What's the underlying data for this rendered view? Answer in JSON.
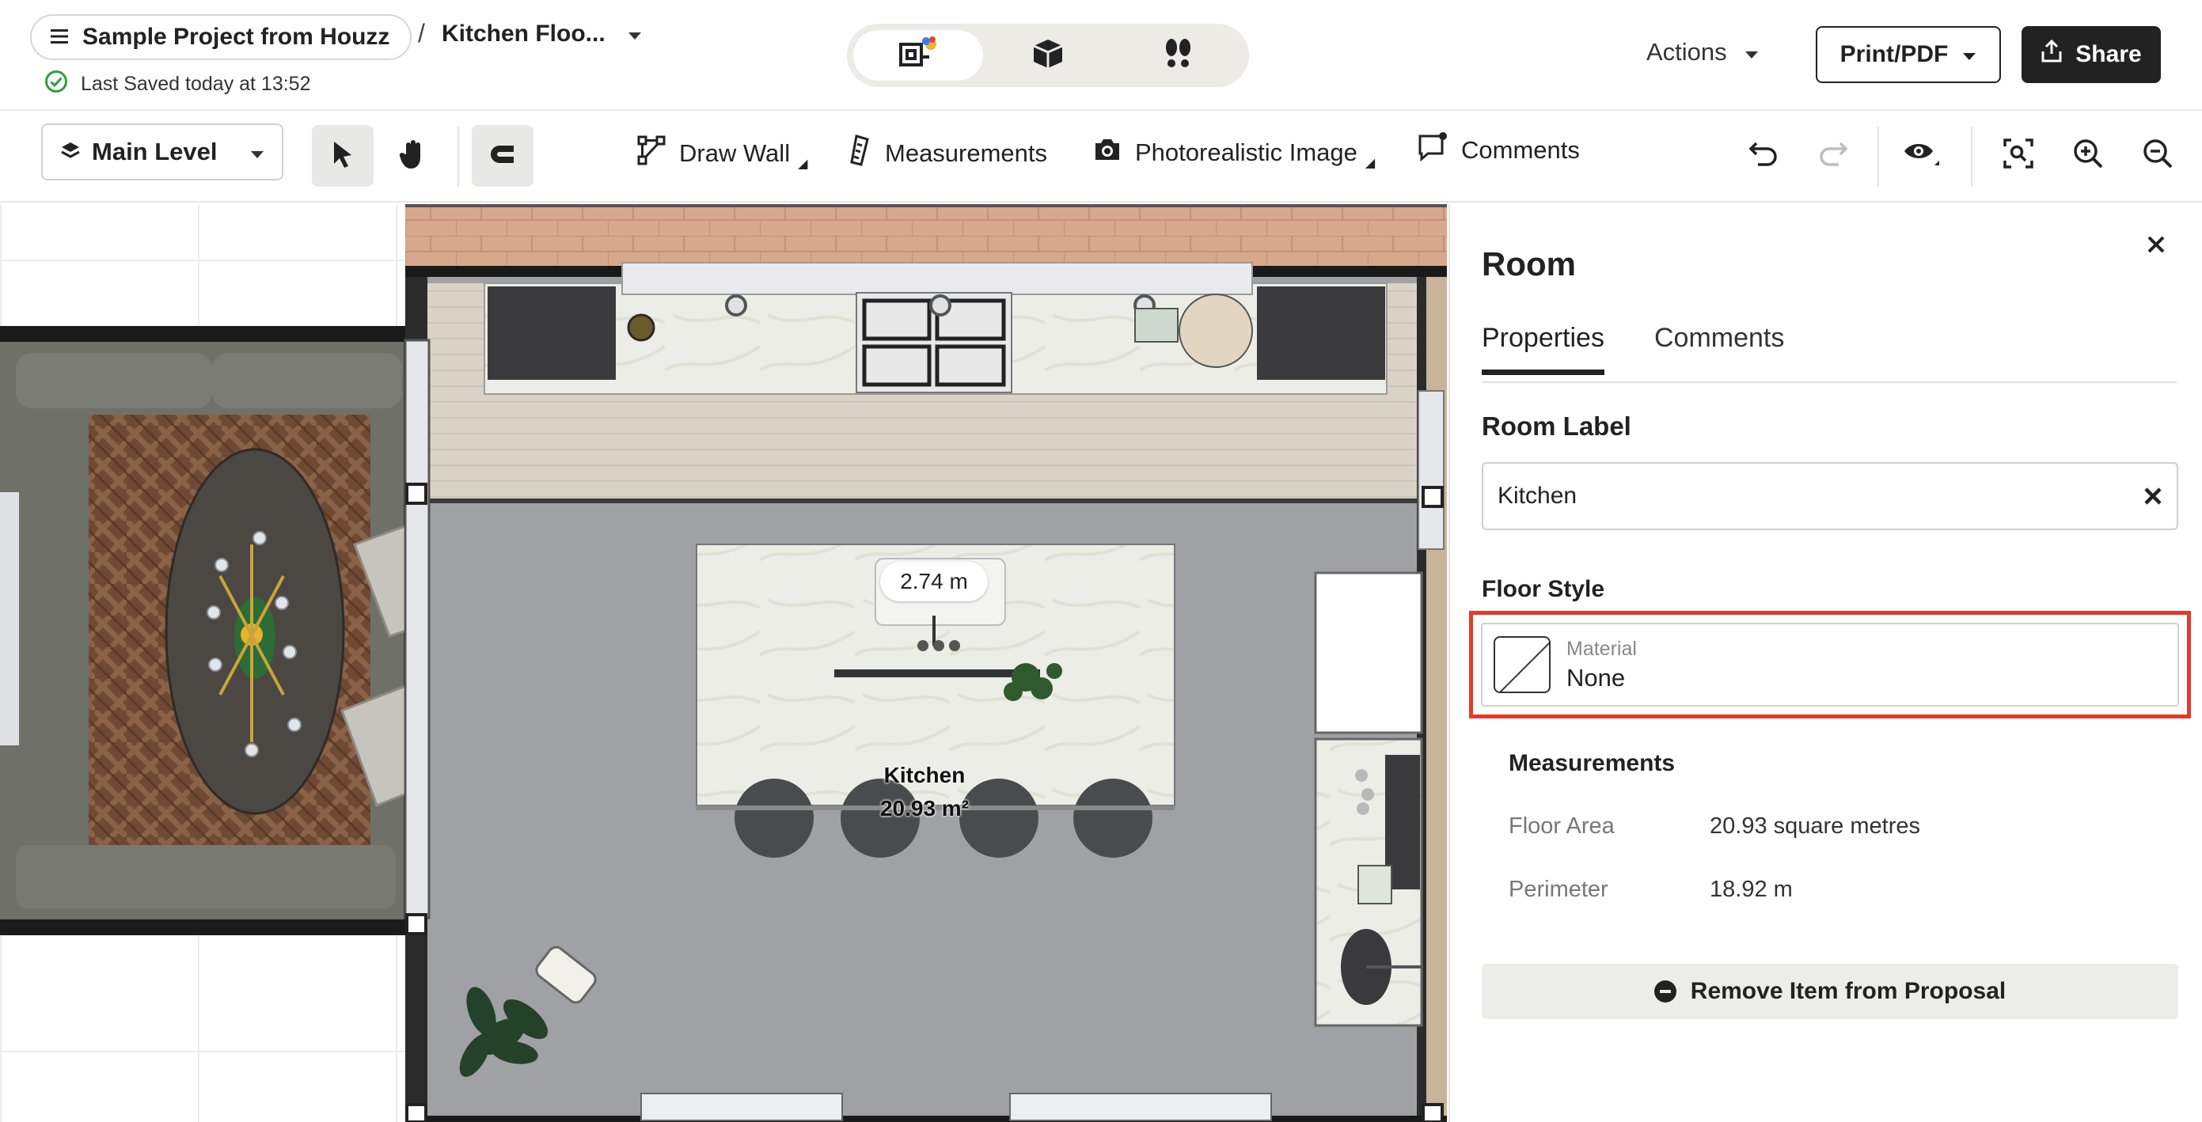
{
  "header": {
    "project_name": "Sample Project from Houzz",
    "separator": "/",
    "document_name": "Kitchen Floo...",
    "saved_status": "Last Saved today at 13:52",
    "view_modes": [
      "2d-floor-plan-icon",
      "3d-box-icon",
      "walkthrough-footsteps-icon"
    ],
    "actions_label": "Actions",
    "print_label": "Print/PDF",
    "share_label": "Share"
  },
  "toolbar": {
    "level_label": "Main Level",
    "draw_wall_label": "Draw Wall",
    "measurements_label": "Measurements",
    "photoreal_label": "Photorealistic Image",
    "comments_label": "Comments"
  },
  "canvas": {
    "dimension_label": "2.74 m",
    "room_name": "Kitchen",
    "room_area": "20.93 m²"
  },
  "panel": {
    "title": "Room",
    "tabs": [
      "Properties",
      "Comments"
    ],
    "room_label_heading": "Room Label",
    "room_label_value": "Kitchen",
    "floor_style_heading": "Floor Style",
    "material_caption": "Material",
    "material_value": "None",
    "measurements_heading": "Measurements",
    "floor_area_key": "Floor Area",
    "floor_area_value": "20.93 square metres",
    "perimeter_key": "Perimeter",
    "perimeter_value": "18.92 m",
    "remove_label": "Remove Item from Proposal"
  },
  "colors": {
    "highlight": "#e23b2a",
    "accent_dark": "#222222",
    "saved_ok": "#2e9e3e"
  }
}
